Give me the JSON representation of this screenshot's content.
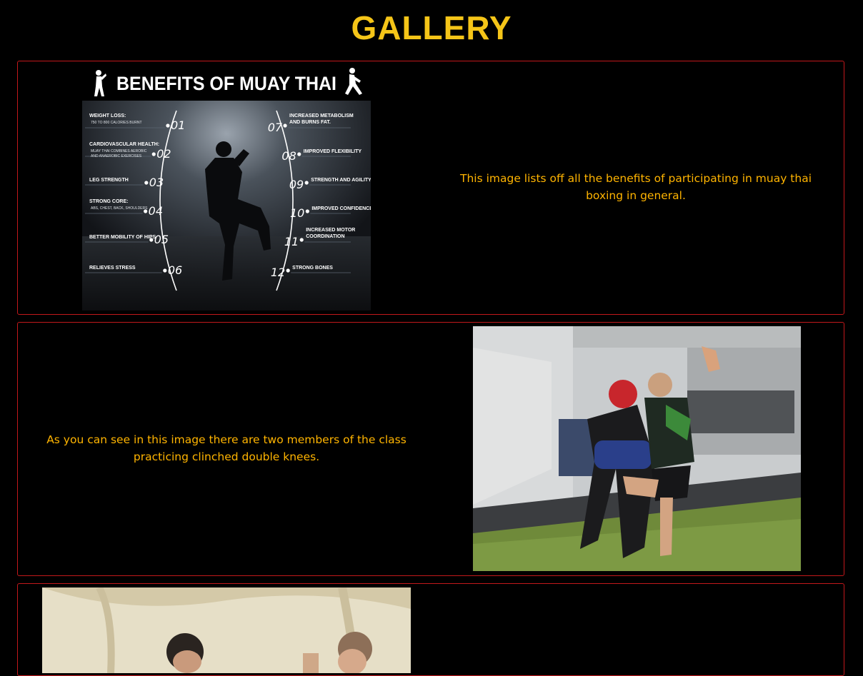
{
  "header": {
    "title": "GALLERY"
  },
  "colors": {
    "accent": "#f5c518",
    "text": "#ffb400",
    "border": "#c2181b",
    "background": "#000000"
  },
  "gallery": [
    {
      "caption": "This image lists off all the benefits of participating in muay thai boxing in general.",
      "image": {
        "title": "BENEFITS OF MUAY THAI",
        "left_items": [
          {
            "num": "01",
            "label": "WEIGHT LOSS:",
            "sub1": "750 TO 800 CALORIES BURNT",
            "sub2": ""
          },
          {
            "num": "02",
            "label": "CARDIOVASCULAR HEALTH:",
            "sub1": "MUAY THAI COMBINES AEROBIC",
            "sub2": "AND ANAEROBIC EXERCISES"
          },
          {
            "num": "03",
            "label": "LEG STRENGTH",
            "sub1": "",
            "sub2": ""
          },
          {
            "num": "04",
            "label": "STRONG CORE:",
            "sub1": "ABS, CHEST, BACK, SHOULDERS",
            "sub2": ""
          },
          {
            "num": "05",
            "label": "BETTER MOBILITY OF HIPS",
            "sub1": "",
            "sub2": ""
          },
          {
            "num": "06",
            "label": "RELIEVES STRESS",
            "sub1": "",
            "sub2": ""
          }
        ],
        "right_items": [
          {
            "num": "07",
            "label": "INCREASED METABOLISM",
            "label2": "AND BURNS FAT."
          },
          {
            "num": "08",
            "label": "IMPROVED FLEXIBILITY",
            "label2": ""
          },
          {
            "num": "09",
            "label": "STRENGTH AND AGILITY",
            "label2": ""
          },
          {
            "num": "10",
            "label": "IMPROVED CONFIDENCE",
            "label2": ""
          },
          {
            "num": "11",
            "label": "INCREASED MOTOR",
            "label2": "COORDINATION"
          },
          {
            "num": "12",
            "label": "STRONG BONES",
            "label2": ""
          }
        ]
      }
    },
    {
      "caption": "As you can see in this image there are two members of the class practicing clinched double knees."
    },
    {
      "caption": ""
    }
  ]
}
